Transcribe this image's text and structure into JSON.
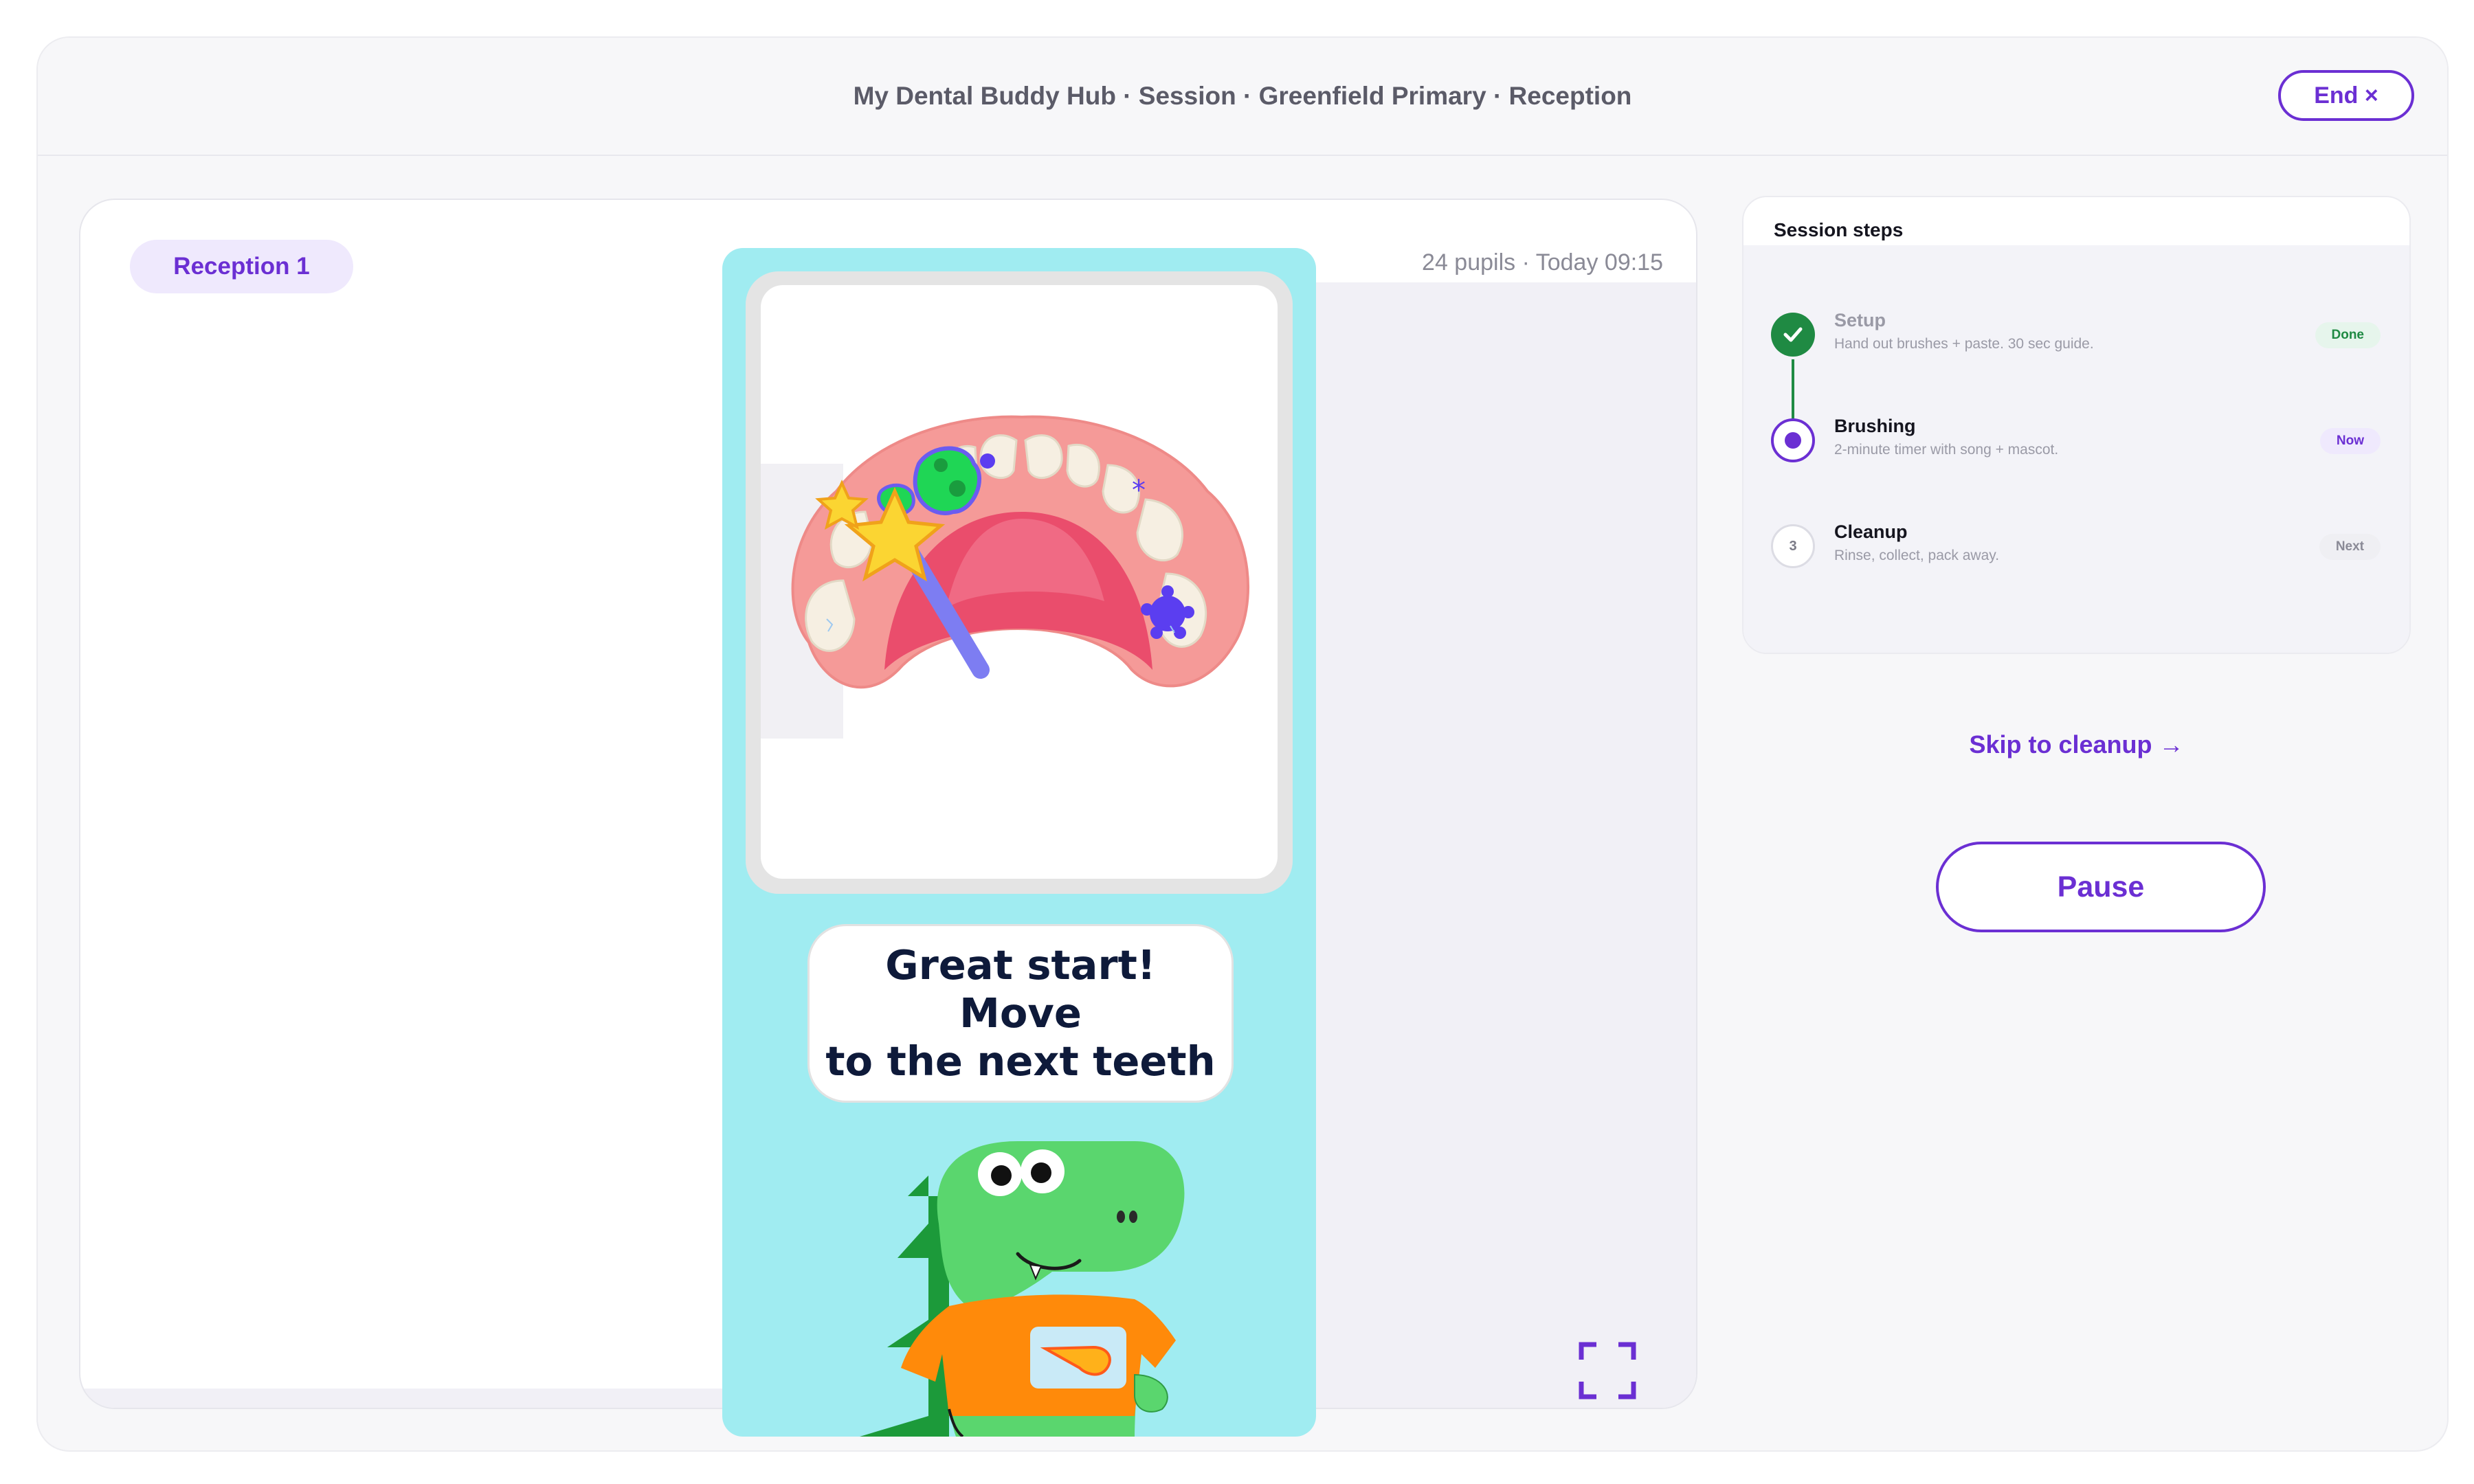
{
  "header": {
    "title": "My Dental Buddy Hub · Session · Greenfield Primary · Reception",
    "end_label": "End ×"
  },
  "stage": {
    "group_label": "Reception 1",
    "meta": "24 pupils · Today 09:15"
  },
  "game": {
    "message": [
      "Great start!",
      "Move",
      "to the next teeth"
    ],
    "mascot": "dinosaur-mascot"
  },
  "steps": {
    "title": "Session steps",
    "items": [
      {
        "name": "Setup",
        "description": "Hand out brushes + paste. 30 sec guide.",
        "badge": "Done",
        "state": "done"
      },
      {
        "name": "Brushing",
        "description": "2-minute timer with song + mascot.",
        "badge": "Now",
        "state": "current"
      },
      {
        "name": "Cleanup",
        "description": "Rinse, collect, pack away.",
        "badge": "Next",
        "state": "next",
        "number": "3"
      }
    ]
  },
  "actions": {
    "skip_label": "Skip to cleanup →",
    "pause_label": "Pause"
  },
  "colors": {
    "accent": "#6b2fd3",
    "done": "#1f8a43",
    "game_bg": "#a0ecf1",
    "gum": "#f59a98",
    "mascot_green": "#5ad66e",
    "shirt_orange": "#ff8a0a"
  }
}
